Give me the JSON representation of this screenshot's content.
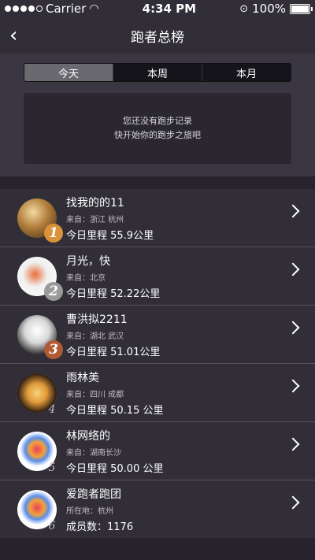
{
  "status": {
    "carrier": "Carrier",
    "time": "4:34 PM",
    "battery": "100%"
  },
  "nav": {
    "title": "跑者总榜"
  },
  "tabs": [
    "今天",
    "本周",
    "本月"
  ],
  "empty": {
    "line1": "您还没有跑步记录",
    "line2": "快开始你的跑步之旅吧"
  },
  "rows": [
    {
      "rank": "1",
      "name": "找我的的11",
      "from": "来自：浙江  杭州",
      "dist": "今日里程 55.9公里"
    },
    {
      "rank": "2",
      "name": "月光，快",
      "from": "来自：北京",
      "dist": "今日里程 52.22公里"
    },
    {
      "rank": "3",
      "name": "曹洪拟2211",
      "from": "来自：湖北  武汉",
      "dist": "今日里程 51.01公里"
    },
    {
      "rank": "4",
      "name": "雨林美",
      "from": "来自：四川  成都",
      "dist": "今日里程 50.15 公里"
    },
    {
      "rank": "5",
      "name": "林网络的",
      "from": "来自：湖南长沙",
      "dist": "今日里程 50.00 公里"
    },
    {
      "rank": "6",
      "name": "爱跑者跑团",
      "from": "所在地：杭州",
      "dist": "成员数：1176"
    }
  ]
}
